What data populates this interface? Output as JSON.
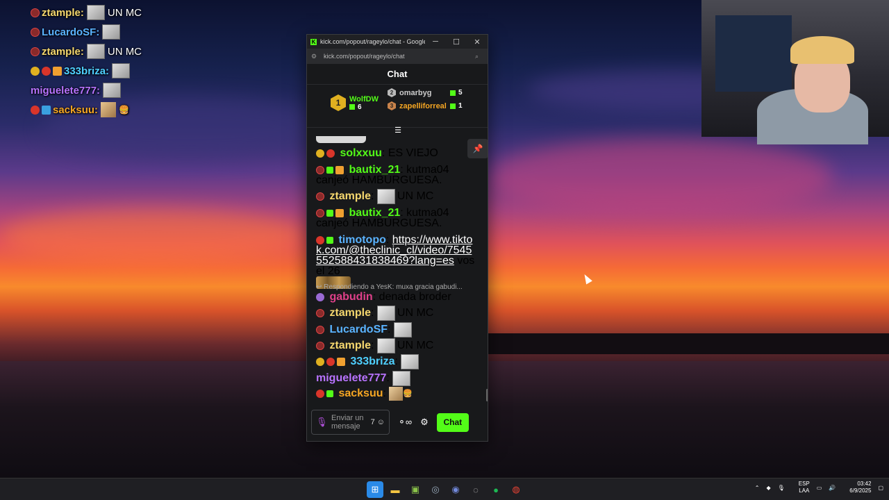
{
  "overlay": {
    "lines": [
      {
        "user": "ztample",
        "text": "UN MC",
        "color": "#f5d76e"
      },
      {
        "user": "LucardoSF",
        "text": "",
        "color": "#5ab3ff"
      },
      {
        "user": "ztample",
        "text": "UN MC",
        "color": "#f5d76e"
      },
      {
        "user": "333briza",
        "text": "",
        "color": "#4fd0ff"
      },
      {
        "user": "miguelete777",
        "text": "",
        "color": "#b873ff"
      },
      {
        "user": "sacksuu",
        "text": "",
        "color": "#f5a623"
      }
    ]
  },
  "window": {
    "title": "kick.com/popout/rageylo/chat - Google...",
    "url": "kick.com/popout/rageylo/chat",
    "minimize": "─",
    "maximize": "☐",
    "close": "✕"
  },
  "chat": {
    "header": "Chat",
    "leaderboard": {
      "first": {
        "rank": "1",
        "name": "WolfDW",
        "count": "6"
      },
      "second": {
        "rank": "2",
        "name": "omarbyg",
        "count": "5"
      },
      "third": {
        "rank": "3",
        "name": "zapelliforreal",
        "count": "1"
      }
    },
    "messages": {
      "m1": {
        "user": "solxxuu",
        "text": "ES VIEJO",
        "color": "#53fc18"
      },
      "m2": {
        "user": "bautix_21",
        "text": "kutma04 canjeó HAMBURGUESA.",
        "color": "#53fc18"
      },
      "m3": {
        "user": "ztample",
        "text": "UN MC",
        "color": "#f5d76e"
      },
      "m4": {
        "user": "bautix_21",
        "text": "kutma04 canjeó HAMBURGUESA.",
        "color": "#53fc18"
      },
      "m5": {
        "user": "timotopo",
        "link": "https://www.tiktok.com/@theclinic_cl/video/7545552588431838469?lang=es",
        "text": "vos el 26",
        "color": "#5ab3ff"
      },
      "m6_reply": "Respondiendo a YesK: muxa gracia gabudi...",
      "m6": {
        "user": "gabudin",
        "text": "denada broder",
        "color": "#e0408a"
      },
      "m7": {
        "user": "ztample",
        "text": "UN MC",
        "color": "#f5d76e"
      },
      "m8": {
        "user": "LucardoSF",
        "text": "",
        "color": "#5ab3ff"
      },
      "m9": {
        "user": "ztample",
        "text": "UN MC",
        "color": "#f5d76e"
      },
      "m10": {
        "user": "333briza",
        "text": "",
        "color": "#4fd0ff"
      },
      "m11": {
        "user": "miguelete777",
        "text": "",
        "color": "#b873ff"
      },
      "m12": {
        "user": "sacksuu",
        "text": "",
        "color": "#f5a623"
      }
    },
    "composer": {
      "placeholder": "Enviar un mensaje",
      "send_label": "Chat"
    }
  },
  "taskbar": {
    "lang_top": "ESP",
    "lang_bottom": "LAA",
    "time": "03:42",
    "date": "6/9/2025"
  }
}
